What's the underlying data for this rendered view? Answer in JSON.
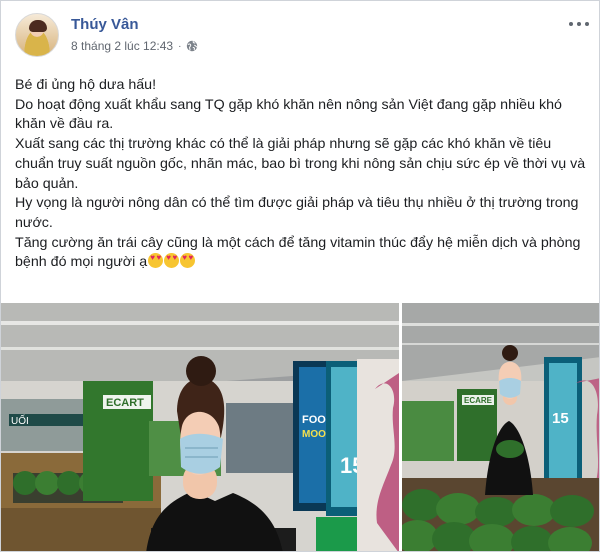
{
  "author": {
    "name": "Thúy Vân",
    "avatar_icon": "avatar-photo"
  },
  "meta": {
    "timestamp": "8 tháng 2 lúc 12:43",
    "separator": "·",
    "privacy_icon": "globe-icon"
  },
  "more_menu_icon": "more-options-icon",
  "post_lines": [
    "Bé đi ủng hộ dưa hấu!",
    "Do hoạt động xuất khẩu sang TQ gặp khó khăn nên nông sản Việt đang gặp nhiều khó khăn về đầu ra.",
    "Xuất sang các thị trường khác có thể là giải pháp nhưng sẽ gặp các khó khăn về tiêu chuẩn truy suất nguồn gốc, nhãn mác, bao bì trong khi nông sản chịu sức ép về thời vụ và bảo quản.",
    "Hy vọng là người nông dân có thể tìm được giải pháp và tiêu thụ nhiều ở thị trường trong nước.",
    "Tăng cường ăn trái cây cũng là một cách để tăng vitamin thúc đẩy hệ miễn dịch và phòng bệnh đó mọi người ạ"
  ],
  "emojis": [
    "heart-eyes-emoji",
    "heart-eyes-emoji",
    "heart-eyes-emoji"
  ],
  "photos": {
    "left": {
      "signage": [
        "ECART",
        "UỐI",
        "FOOD",
        "MOOD!",
        "15"
      ]
    },
    "right": {
      "signage": [
        "ECARE",
        "15"
      ]
    }
  },
  "colors": {
    "author": "#385898",
    "meta": "#616770",
    "text": "#1c1e21",
    "mask": "#a9cfe2",
    "watermelon": "#2f6f2b"
  }
}
